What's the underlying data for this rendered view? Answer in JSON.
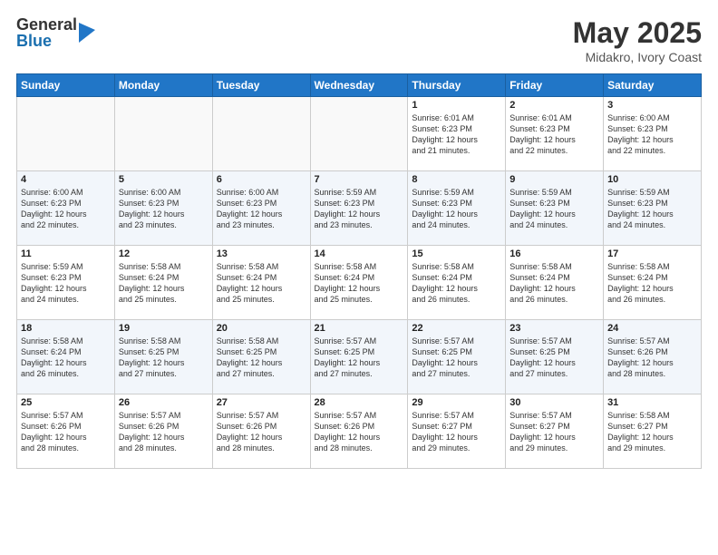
{
  "logo": {
    "general": "General",
    "blue": "Blue"
  },
  "title": "May 2025",
  "subtitle": "Midakro, Ivory Coast",
  "weekdays": [
    "Sunday",
    "Monday",
    "Tuesday",
    "Wednesday",
    "Thursday",
    "Friday",
    "Saturday"
  ],
  "weeks": [
    [
      {
        "day": "",
        "text": ""
      },
      {
        "day": "",
        "text": ""
      },
      {
        "day": "",
        "text": ""
      },
      {
        "day": "",
        "text": ""
      },
      {
        "day": "1",
        "text": "Sunrise: 6:01 AM\nSunset: 6:23 PM\nDaylight: 12 hours\nand 21 minutes."
      },
      {
        "day": "2",
        "text": "Sunrise: 6:01 AM\nSunset: 6:23 PM\nDaylight: 12 hours\nand 22 minutes."
      },
      {
        "day": "3",
        "text": "Sunrise: 6:00 AM\nSunset: 6:23 PM\nDaylight: 12 hours\nand 22 minutes."
      }
    ],
    [
      {
        "day": "4",
        "text": "Sunrise: 6:00 AM\nSunset: 6:23 PM\nDaylight: 12 hours\nand 22 minutes."
      },
      {
        "day": "5",
        "text": "Sunrise: 6:00 AM\nSunset: 6:23 PM\nDaylight: 12 hours\nand 23 minutes."
      },
      {
        "day": "6",
        "text": "Sunrise: 6:00 AM\nSunset: 6:23 PM\nDaylight: 12 hours\nand 23 minutes."
      },
      {
        "day": "7",
        "text": "Sunrise: 5:59 AM\nSunset: 6:23 PM\nDaylight: 12 hours\nand 23 minutes."
      },
      {
        "day": "8",
        "text": "Sunrise: 5:59 AM\nSunset: 6:23 PM\nDaylight: 12 hours\nand 24 minutes."
      },
      {
        "day": "9",
        "text": "Sunrise: 5:59 AM\nSunset: 6:23 PM\nDaylight: 12 hours\nand 24 minutes."
      },
      {
        "day": "10",
        "text": "Sunrise: 5:59 AM\nSunset: 6:23 PM\nDaylight: 12 hours\nand 24 minutes."
      }
    ],
    [
      {
        "day": "11",
        "text": "Sunrise: 5:59 AM\nSunset: 6:23 PM\nDaylight: 12 hours\nand 24 minutes."
      },
      {
        "day": "12",
        "text": "Sunrise: 5:58 AM\nSunset: 6:24 PM\nDaylight: 12 hours\nand 25 minutes."
      },
      {
        "day": "13",
        "text": "Sunrise: 5:58 AM\nSunset: 6:24 PM\nDaylight: 12 hours\nand 25 minutes."
      },
      {
        "day": "14",
        "text": "Sunrise: 5:58 AM\nSunset: 6:24 PM\nDaylight: 12 hours\nand 25 minutes."
      },
      {
        "day": "15",
        "text": "Sunrise: 5:58 AM\nSunset: 6:24 PM\nDaylight: 12 hours\nand 26 minutes."
      },
      {
        "day": "16",
        "text": "Sunrise: 5:58 AM\nSunset: 6:24 PM\nDaylight: 12 hours\nand 26 minutes."
      },
      {
        "day": "17",
        "text": "Sunrise: 5:58 AM\nSunset: 6:24 PM\nDaylight: 12 hours\nand 26 minutes."
      }
    ],
    [
      {
        "day": "18",
        "text": "Sunrise: 5:58 AM\nSunset: 6:24 PM\nDaylight: 12 hours\nand 26 minutes."
      },
      {
        "day": "19",
        "text": "Sunrise: 5:58 AM\nSunset: 6:25 PM\nDaylight: 12 hours\nand 27 minutes."
      },
      {
        "day": "20",
        "text": "Sunrise: 5:58 AM\nSunset: 6:25 PM\nDaylight: 12 hours\nand 27 minutes."
      },
      {
        "day": "21",
        "text": "Sunrise: 5:57 AM\nSunset: 6:25 PM\nDaylight: 12 hours\nand 27 minutes."
      },
      {
        "day": "22",
        "text": "Sunrise: 5:57 AM\nSunset: 6:25 PM\nDaylight: 12 hours\nand 27 minutes."
      },
      {
        "day": "23",
        "text": "Sunrise: 5:57 AM\nSunset: 6:25 PM\nDaylight: 12 hours\nand 27 minutes."
      },
      {
        "day": "24",
        "text": "Sunrise: 5:57 AM\nSunset: 6:26 PM\nDaylight: 12 hours\nand 28 minutes."
      }
    ],
    [
      {
        "day": "25",
        "text": "Sunrise: 5:57 AM\nSunset: 6:26 PM\nDaylight: 12 hours\nand 28 minutes."
      },
      {
        "day": "26",
        "text": "Sunrise: 5:57 AM\nSunset: 6:26 PM\nDaylight: 12 hours\nand 28 minutes."
      },
      {
        "day": "27",
        "text": "Sunrise: 5:57 AM\nSunset: 6:26 PM\nDaylight: 12 hours\nand 28 minutes."
      },
      {
        "day": "28",
        "text": "Sunrise: 5:57 AM\nSunset: 6:26 PM\nDaylight: 12 hours\nand 28 minutes."
      },
      {
        "day": "29",
        "text": "Sunrise: 5:57 AM\nSunset: 6:27 PM\nDaylight: 12 hours\nand 29 minutes."
      },
      {
        "day": "30",
        "text": "Sunrise: 5:57 AM\nSunset: 6:27 PM\nDaylight: 12 hours\nand 29 minutes."
      },
      {
        "day": "31",
        "text": "Sunrise: 5:58 AM\nSunset: 6:27 PM\nDaylight: 12 hours\nand 29 minutes."
      }
    ]
  ]
}
